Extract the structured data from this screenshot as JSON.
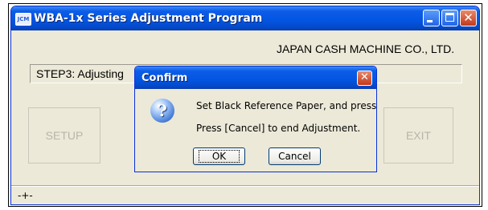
{
  "window": {
    "title": "WBA-1x Series Adjustment Program",
    "app_icon_text": "JCM"
  },
  "main": {
    "company": "JAPAN CASH MACHINE CO., LTD.",
    "step_text": "STEP3: Adjusting",
    "setup_label": "SETUP",
    "exit_label": "EXIT",
    "status_text": "-+-"
  },
  "dialog": {
    "title": "Confirm",
    "close_glyph": "✕",
    "icon_glyph": "?",
    "message_line1": "Set Black Reference Paper, and press [OK]",
    "message_line2": "Press [Cancel] to end Adjustment.",
    "ok_label": "OK",
    "cancel_label": "Cancel"
  },
  "titlebar_buttons": {
    "close_glyph": "✕"
  },
  "colors": {
    "titlebar": "#0355e0",
    "window_bg": "#ece9d8",
    "close_red": "#c1391c"
  }
}
